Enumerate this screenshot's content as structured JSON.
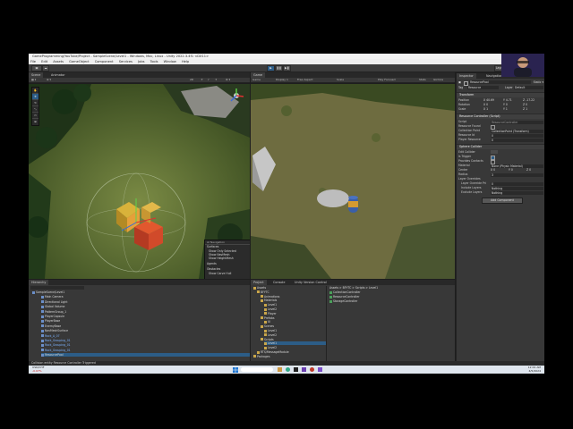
{
  "window": {
    "title": "GameProgramming/YouTube/Project - SampleScene/Level1 - Windows, Mac, Linux - Unity 2022.3.4f1 <DX11>",
    "controls": [
      "–",
      "□",
      "✕"
    ]
  },
  "menubar": [
    "File",
    "Edit",
    "Assets",
    "GameObject",
    "Component",
    "Services",
    "Jobs",
    "Tools",
    "Window",
    "Help"
  ],
  "toolbar": {
    "play": "▶",
    "pause": "❚❚",
    "step": "▶❚"
  },
  "scene_tabs": [
    "Scene",
    "Animator"
  ],
  "game_tabs": [
    "Game"
  ],
  "game_bar": {
    "display": "Game",
    "display_num": "Display 1",
    "aspect": "Free Aspect",
    "scale": "Scale",
    "play_focused": "Play Focused",
    "stats": "Stats",
    "gizmos": "Gizmos"
  },
  "scene_overlay": {
    "title": "AI Navigation",
    "items": [
      "Surfaces",
      "Show Only Selected",
      "Show NavMesh",
      "Show HeightMesh",
      "Agents",
      "Obstacles",
      "Show Carve Hull"
    ]
  },
  "inspector": {
    "tabs": [
      "Inspector",
      "Navigation"
    ],
    "object_name": "ResourcePool",
    "tag_label": "Tag",
    "tag_value": "Resource",
    "layer_label": "Layer",
    "layer_value": "Default",
    "transform": {
      "title": "Transform",
      "position_label": "Position",
      "position": [
        "X 40.69",
        "Y 4.71",
        "Z -17.22"
      ],
      "rotation_label": "Rotation",
      "rotation": [
        "X 0",
        "Y 0",
        "Z 0"
      ],
      "scale_label": "Scale",
      "scale": [
        "X 1",
        "Y 1",
        "Z 1"
      ]
    },
    "resource_controller": {
      "title": "Resource Controller (Script)",
      "script_label": "Script",
      "script_value": "ResourceController",
      "found_label": "Resource Found",
      "collection_label": "Collection Point",
      "collection_value": "CollectionPoint (Transform)",
      "id_label": "Resource Id",
      "id_value": "0",
      "player_label": "Player Resource",
      "player_value": "0"
    },
    "sphere_collider": {
      "title": "Sphere Collider",
      "edit_label": "Edit Collider",
      "trigger_label": "Is Trigger",
      "contacts_label": "Provides Contacts",
      "material_label": "Material",
      "material_value": "None (Physic Material)",
      "center_label": "Center",
      "center": [
        "X 0",
        "Y 0",
        "Z 0"
      ],
      "radius_label": "Radius",
      "radius_value": "3",
      "layer_overrides": "Layer Overrides",
      "priority_label": "Layer Override Pri",
      "priority_value": "0",
      "include_label": "Include Layers",
      "include_value": "Nothing",
      "exclude_label": "Exclude Layers",
      "exclude_value": "Nothing"
    },
    "add_component": "Add Component"
  },
  "hierarchy": {
    "tab": "Hierarchy",
    "items": [
      {
        "label": "SampleScene/Level1",
        "depth": 0
      },
      {
        "label": "Main Camera",
        "depth": 1
      },
      {
        "label": "Directional Light",
        "depth": 1
      },
      {
        "label": "Global Volume",
        "depth": 1
      },
      {
        "label": "PatternGroup_1",
        "depth": 1
      },
      {
        "label": "PlayerCapsule",
        "depth": 1
      },
      {
        "label": "PlayerBase",
        "depth": 1
      },
      {
        "label": "EnemyBase",
        "depth": 1
      },
      {
        "label": "NavMeshSurface",
        "depth": 1
      },
      {
        "label": "Rock_A_07",
        "depth": 1
      },
      {
        "label": "Rock_Grouping_01",
        "depth": 1
      },
      {
        "label": "Rock_Grouping_01",
        "depth": 1
      },
      {
        "label": "Rock_Grouping_01",
        "depth": 1
      },
      {
        "label": "ResourcePool",
        "depth": 1
      }
    ]
  },
  "project": {
    "tabs": [
      "Project",
      "Console",
      "Unity Version Control"
    ],
    "tree": [
      "Assets",
      "BFYTC",
      "Animations",
      "Materials",
      "Level1",
      "Level2",
      "Player",
      "Prefabs",
      "UI",
      "Scenes",
      "Level1",
      "Level2",
      "Scripts",
      "Level1",
      "Level2",
      "RTS/MessageModule",
      "Packages"
    ],
    "breadcrumb": "Assets > BFYTC > Scripts > Level1",
    "files": [
      "CollectionController",
      "ResourceController",
      "StorageController"
    ]
  },
  "statusbar": {
    "message": "Collision entity Resource Controller Triggered"
  },
  "taskbar": {
    "weather": "USD/CHF",
    "weather_sub": "-0.07%",
    "time": "12:01 AM",
    "date": "4/5/2024"
  },
  "colors": {
    "accent": "#2c5d87",
    "editor_bg": "#383838",
    "selection": "#2c5d87"
  }
}
